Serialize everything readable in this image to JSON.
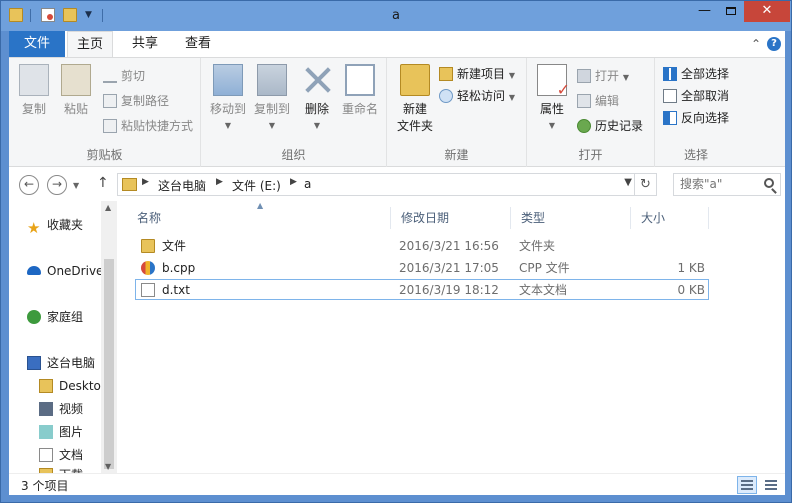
{
  "window": {
    "title": "a",
    "controls": {
      "minimize": "—",
      "maximize": "",
      "close": "✕"
    }
  },
  "ribbon_tabs": {
    "file": "文件",
    "home": "主页",
    "share": "共享",
    "view": "查看",
    "collapse": "⌃",
    "help": "?"
  },
  "ribbon": {
    "clipboard": {
      "label": "剪贴板",
      "copy": "复制",
      "paste": "粘贴",
      "cut": "剪切",
      "copy_path": "复制路径",
      "paste_shortcut": "粘贴快捷方式"
    },
    "organize": {
      "label": "组织",
      "move_to": "移动到",
      "copy_to": "复制到",
      "delete": "删除",
      "rename": "重命名"
    },
    "new": {
      "label": "新建",
      "new_folder_line1": "新建",
      "new_folder_line2": "文件夹",
      "new_item": "新建项目",
      "easy_access": "轻松访问"
    },
    "open": {
      "label": "打开",
      "properties": "属性",
      "open": "打开",
      "edit": "编辑",
      "history": "历史记录"
    },
    "select": {
      "label": "选择",
      "select_all": "全部选择",
      "select_none": "全部取消",
      "invert": "反向选择"
    }
  },
  "address": {
    "crumbs": [
      "这台电脑",
      "文件 (E:)",
      "a"
    ],
    "search_placeholder": "搜索\"a\""
  },
  "nav_pane": {
    "favorites": "收藏夹",
    "onedrive": "OneDrive",
    "homegroup": "家庭组",
    "this_pc": "这台电脑",
    "children": [
      "Desktop",
      "视频",
      "图片",
      "文档",
      "下载"
    ]
  },
  "columns": {
    "name": "名称",
    "date": "修改日期",
    "type": "类型",
    "size": "大小"
  },
  "files": [
    {
      "name": "文件",
      "date": "2016/3/21 16:56",
      "type": "文件夹",
      "size": "",
      "icon": "folder-icon"
    },
    {
      "name": "b.cpp",
      "date": "2016/3/21 17:05",
      "type": "CPP 文件",
      "size": "1 KB",
      "icon": "cpp-file-icon"
    },
    {
      "name": "d.txt",
      "date": "2016/3/19 18:12",
      "type": "文本文档",
      "size": "0 KB",
      "icon": "text-file-icon"
    }
  ],
  "status": {
    "item_count": "3 个项目"
  },
  "colors": {
    "accent": "#2a74c7",
    "title_bar": "#6fa0dc",
    "close_button": "#c7463a",
    "selection_border": "#7eb4ea"
  }
}
